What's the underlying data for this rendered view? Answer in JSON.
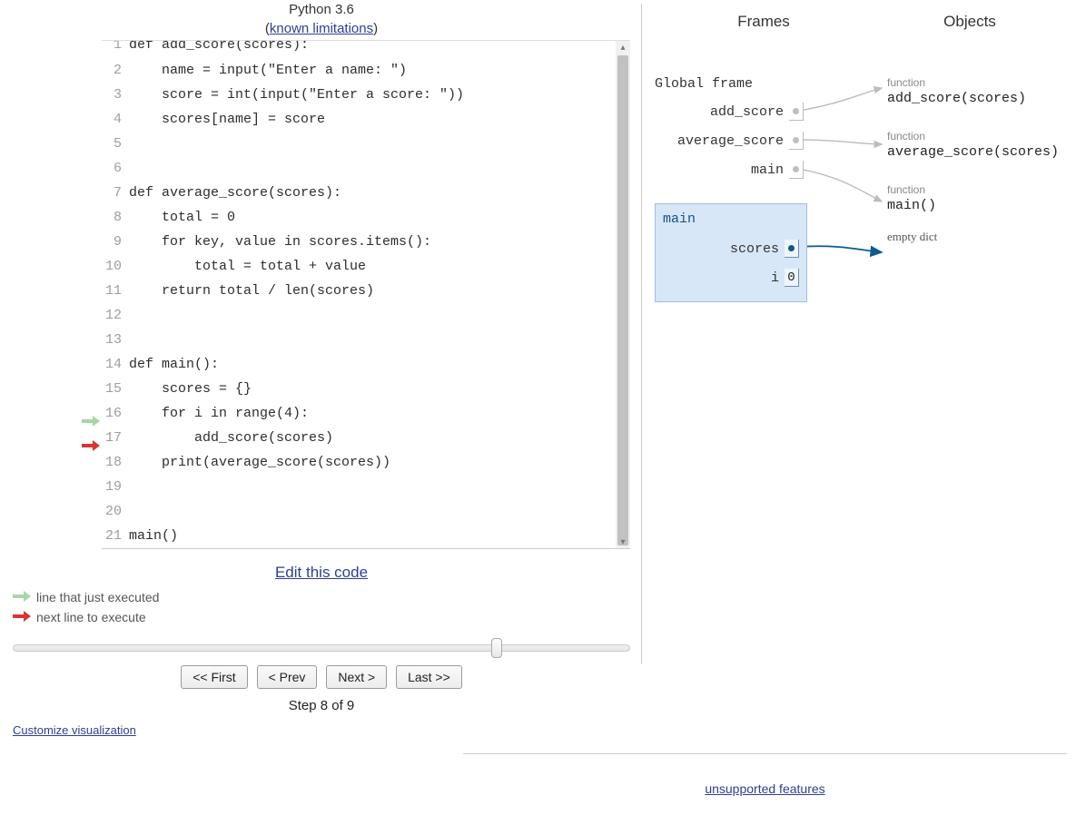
{
  "header": {
    "language": "Python 3.6",
    "limitations_label": "known limitations"
  },
  "code": {
    "lines": [
      "def add_score(scores):",
      "    name = input(\"Enter a name: \")",
      "    score = int(input(\"Enter a score: \"))",
      "    scores[name] = score",
      "",
      "",
      "def average_score(scores):",
      "    total = 0",
      "    for key, value in scores.items():",
      "        total = total + value",
      "    return total / len(scores)",
      "",
      "",
      "def main():",
      "    scores = {}",
      "    for i in range(4):",
      "        add_score(scores)",
      "    print(average_score(scores))",
      "",
      "",
      "main()"
    ],
    "prev_executed_line": 16,
    "next_line": 17
  },
  "links": {
    "edit_code": "Edit this code",
    "customize": "Customize visualization",
    "unsupported": "unsupported features"
  },
  "legend": {
    "just_executed": "line that just executed",
    "next_to_execute": "next line to execute"
  },
  "controls": {
    "first": "<< First",
    "prev": "< Prev",
    "next": "Next >",
    "last": "Last >>",
    "step_current": 8,
    "step_total": 9,
    "step_label": "Step 8 of 9"
  },
  "viz": {
    "frames_header": "Frames",
    "objects_header": "Objects",
    "global_frame": {
      "title": "Global frame",
      "vars": [
        "add_score",
        "average_score",
        "main"
      ]
    },
    "main_frame": {
      "title": "main",
      "vars": [
        {
          "name": "scores",
          "value": "",
          "pointer": true
        },
        {
          "name": "i",
          "value": "0",
          "pointer": false
        }
      ]
    },
    "objects": [
      {
        "kind": "function",
        "sig": "add_score(scores)"
      },
      {
        "kind": "function",
        "sig": "average_score(scores)"
      },
      {
        "kind": "function",
        "sig": "main()"
      },
      {
        "kind": "",
        "sig": "empty dict"
      }
    ]
  }
}
